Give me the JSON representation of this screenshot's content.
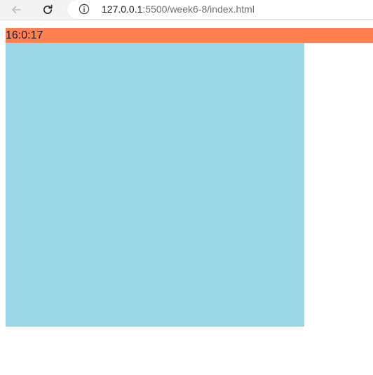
{
  "browser": {
    "url_host": "127.0.0.1",
    "url_path": ":5500/week6-8/index.html"
  },
  "page": {
    "clock_text": "16:0:17",
    "colors": {
      "clock_bar": "#ff7f50",
      "box": "#9ad8e8"
    }
  }
}
